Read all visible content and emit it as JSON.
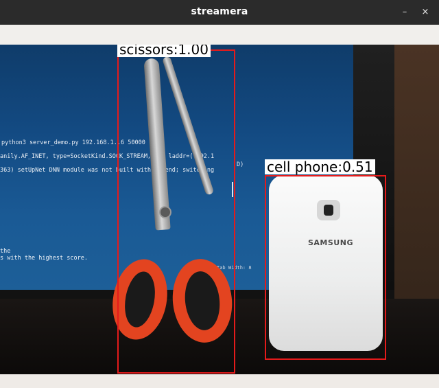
{
  "window": {
    "title": "streamera",
    "minimize_glyph": "–",
    "close_glyph": "×"
  },
  "stream": {
    "terminal_lines": [
      "python3 server_demo.py 192.168.1..6 50000",
      "anily.AF_INET, type=SocketKind.SOCK_STREAM,         =0, laddr=('192.1",
      "363) setUpNet DNN module was not built with          ackend; switching",
      "D)",
      "the",
      "s with the highest score.",
      "Tab Width: 8"
    ],
    "phone_brand": "SAMSUNG"
  },
  "detections": [
    {
      "label": "scissors:1.00",
      "class": "scissors",
      "score": 1.0,
      "color": "#e51b1b"
    },
    {
      "label": "cell phone:0.51",
      "class": "cell phone",
      "score": 0.51,
      "color": "#e51b1b"
    }
  ]
}
